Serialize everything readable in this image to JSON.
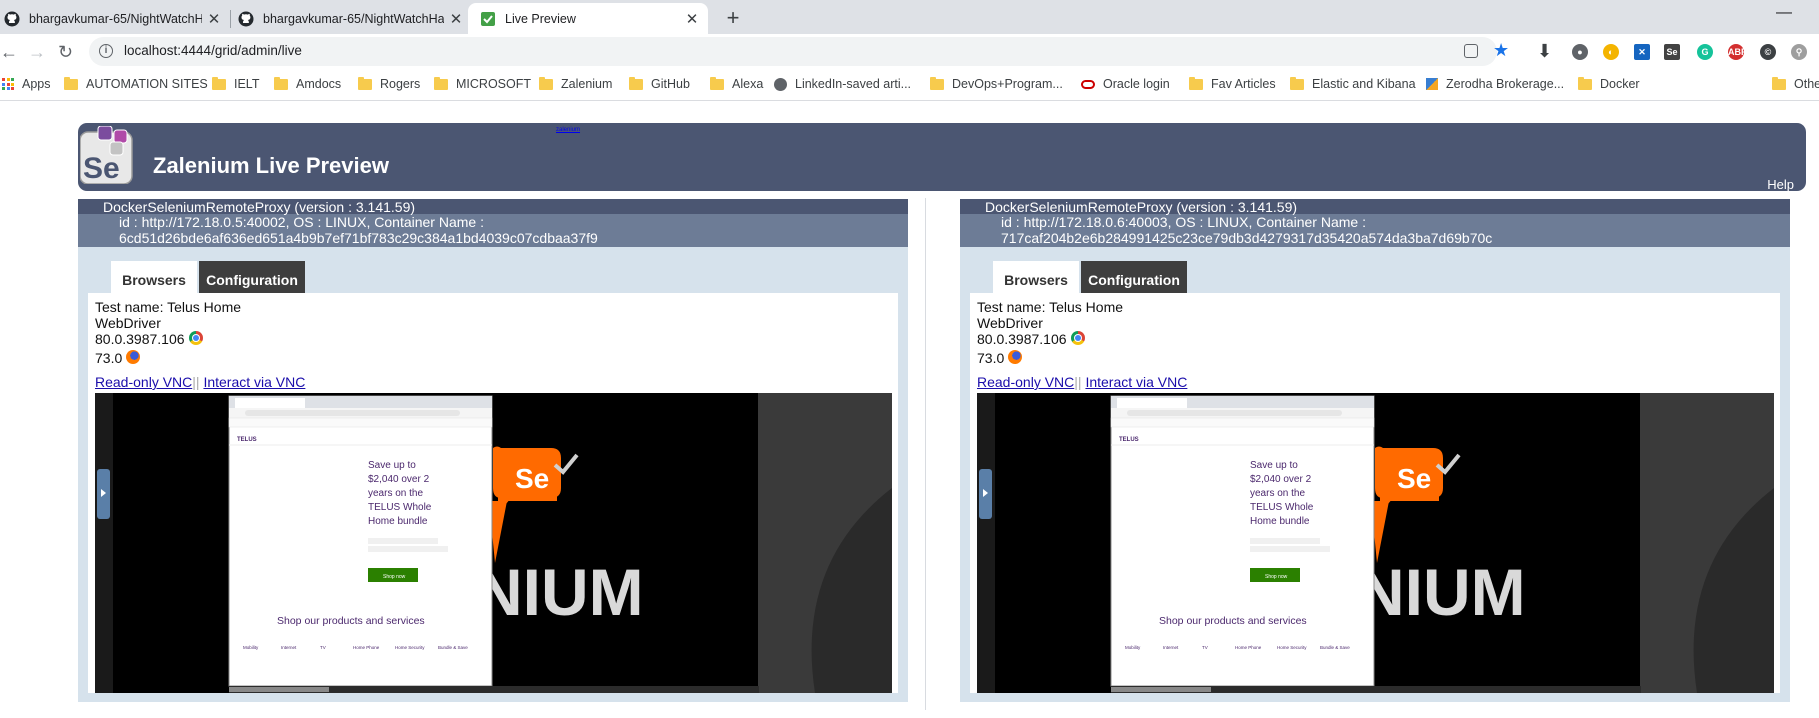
{
  "browser": {
    "tabs": [
      {
        "title": "bhargavkumar-65/NightWatchHa",
        "active": false,
        "favicon": "github-icon"
      },
      {
        "title": "bhargavkumar-65/NightWatchHa",
        "active": false,
        "favicon": "github-icon"
      },
      {
        "title": "Live Preview",
        "active": true,
        "favicon": "zalenium-icon"
      }
    ],
    "new_tab": "+",
    "minimize": "—",
    "url": "localhost:4444/grid/admin/live",
    "bookmarks": [
      {
        "label": "Apps",
        "type": "apps"
      },
      {
        "label": "AUTOMATION SITES",
        "type": "folder"
      },
      {
        "label": "IELT",
        "type": "folder"
      },
      {
        "label": "Amdocs",
        "type": "folder"
      },
      {
        "label": "Rogers",
        "type": "folder"
      },
      {
        "label": "MICROSOFT",
        "type": "folder"
      },
      {
        "label": "Zalenium",
        "type": "folder"
      },
      {
        "label": "GitHub",
        "type": "folder"
      },
      {
        "label": "Alexa",
        "type": "folder"
      },
      {
        "label": "LinkedIn-saved arti...",
        "type": "globe"
      },
      {
        "label": "DevOps+Program...",
        "type": "folder"
      },
      {
        "label": "Oracle login",
        "type": "oracle"
      },
      {
        "label": "Fav Articles",
        "type": "folder"
      },
      {
        "label": "Elastic and Kibana",
        "type": "folder"
      },
      {
        "label": "Zerodha Brokerage...",
        "type": "zerodha"
      },
      {
        "label": "Docker",
        "type": "folder"
      },
      {
        "label": "Othe",
        "type": "folder"
      }
    ]
  },
  "page": {
    "title": "Zalenium Live Preview",
    "help": "Help",
    "logo_text": "Se",
    "nodes": [
      {
        "proxy": "DockerSeleniumRemoteProxy (version : 3.141.59)",
        "id_line": "id : http://172.18.0.5:40002, OS : LINUX, Container Name :",
        "container": "6cd51d26bde6af636ed651a4b9b7ef71bf783c29c384a1bd4039c07cdbaa37f9",
        "tab_browsers": "Browsers",
        "tab_configuration": "Configuration",
        "test_name": "Test name: Telus Home",
        "webdriver": "WebDriver",
        "chrome_version": "80.0.3987.106",
        "firefox_version": "73.0",
        "vnc_readonly": "Read-only VNC",
        "vnc_separator": "||",
        "vnc_interact": "Interact via VNC"
      },
      {
        "proxy": "DockerSeleniumRemoteProxy (version : 3.141.59)",
        "id_line": "id : http://172.18.0.6:40003, OS : LINUX, Container Name :",
        "container": "717caf204b2e6b284991425c23ce79db3d4279317d35420a574da3ba7d69b70c",
        "tab_browsers": "Browsers",
        "tab_configuration": "Configuration",
        "test_name": "Test name: Telus Home",
        "webdriver": "WebDriver",
        "chrome_version": "80.0.3987.106",
        "firefox_version": "73.0",
        "vnc_readonly": "Read-only VNC",
        "vnc_separator": "||",
        "vnc_interact": "Interact via VNC"
      }
    ],
    "vnc_screen": {
      "zalenium_wordmark": "NIUM",
      "se_badge": "Se",
      "inner_page": {
        "brand": "TELUS",
        "headline": "Save up to $2,040 over 2 years on the TELUS Whole Home bundle",
        "cta": "Shop now",
        "section": "Shop our products and services",
        "products": [
          "Mobility",
          "Internet",
          "TV",
          "Home Phone",
          "Home Security",
          "Bundle & Save"
        ]
      }
    }
  },
  "colors": {
    "header_bg": "#4b5672",
    "proxy_bg": "#6d7c96",
    "panel_bg": "#d6e2ec",
    "config_tab_bg": "#3e3e3e",
    "zalenium_orange": "#ff6a00",
    "telus_green": "#2b8000",
    "link": "#1a0dab"
  }
}
